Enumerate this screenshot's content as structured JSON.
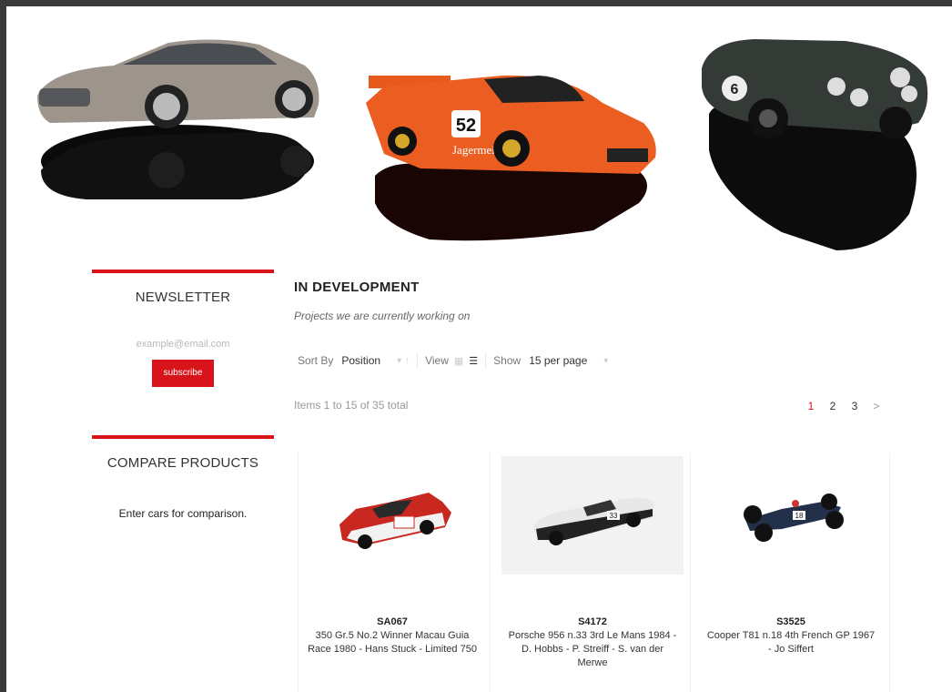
{
  "hero": {
    "cars": [
      "silver-grand-tourer",
      "orange-racing-car-52",
      "green-vintage-racer-6"
    ],
    "race_numbers": {
      "orange": "52",
      "green": "6"
    },
    "livery_text": "Jagermeister"
  },
  "newsletter": {
    "title": "NEWSLETTER",
    "email_placeholder": "example@email.com",
    "subscribe_label": "subscribe"
  },
  "compare": {
    "title": "COMPARE PRODUCTS",
    "empty_text": "Enter cars for comparison."
  },
  "category": {
    "title": "IN DEVELOPMENT",
    "subtitle": "Projects we are currently working on"
  },
  "toolbar": {
    "sort_label": "Sort By",
    "sort_value": "Position",
    "view_label": "View",
    "show_label": "Show",
    "show_value": "15 per page"
  },
  "listing": {
    "items_total": "Items 1 to 15 of 35 total",
    "pages": [
      "1",
      "2",
      "3"
    ],
    "current_page": "1",
    "next_symbol": ">"
  },
  "products": [
    {
      "sku": "SA067",
      "name": "350 Gr.5 No.2 Winner Macau Guia Race 1980 - Hans Stuck - Limited 750"
    },
    {
      "sku": "S4172",
      "name": "Porsche 956 n.33 3rd Le Mans 1984 - D. Hobbs - P. Streiff - S. van der Merwe",
      "number": "33"
    },
    {
      "sku": "S3525",
      "name": "Cooper T81 n.18 4th French GP 1967 - Jo Siffert",
      "number": "18"
    }
  ],
  "colors": {
    "accent": "#d8131a",
    "frame": "#3a3a3a"
  }
}
